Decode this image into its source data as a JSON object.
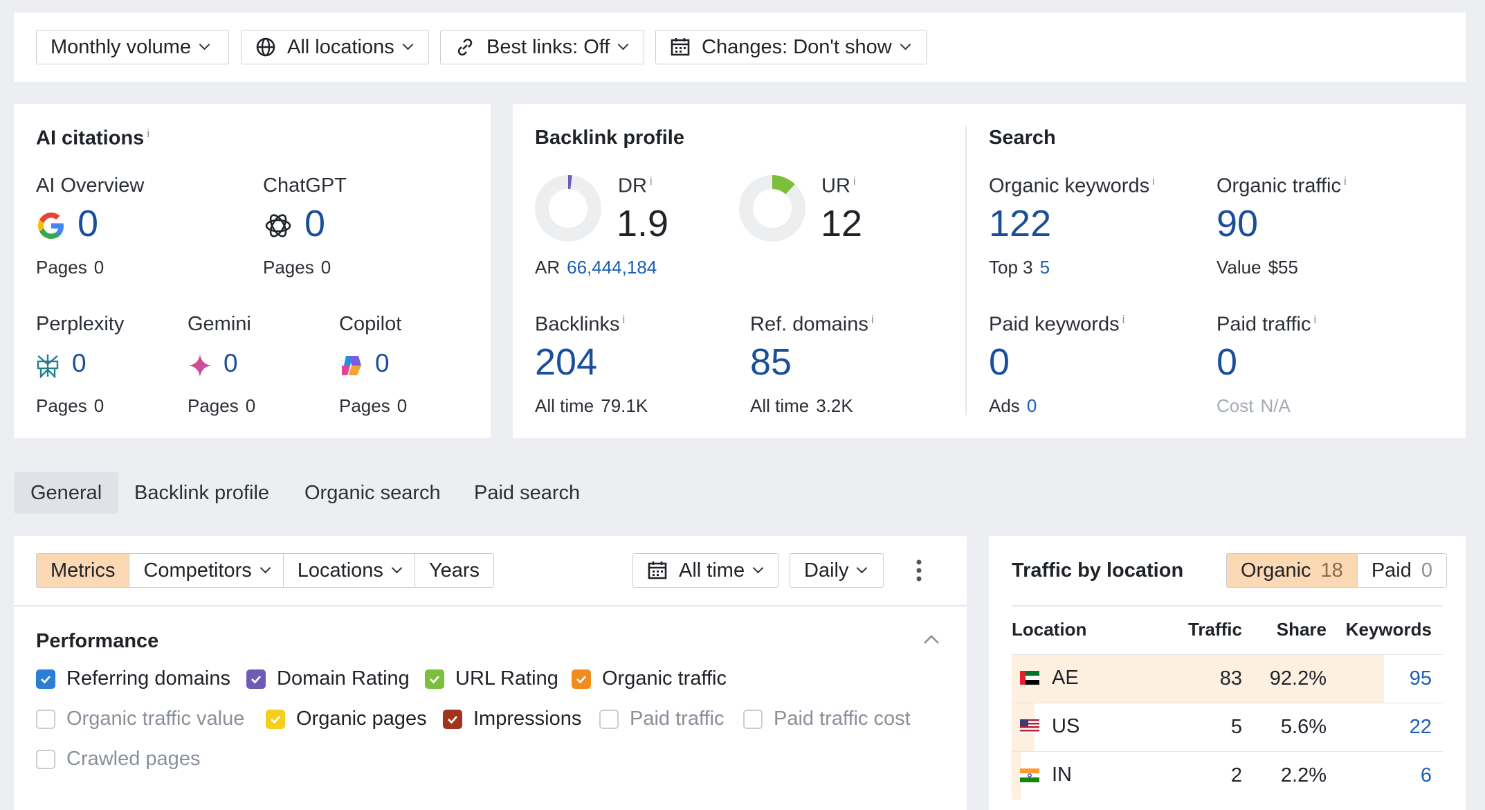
{
  "filters": {
    "volume": "Monthly volume",
    "locations": "All locations",
    "best_links": "Best links: Off",
    "changes": "Changes: Don't show"
  },
  "ai_citations": {
    "title": "AI citations",
    "info": "i",
    "overview": {
      "label": "AI Overview",
      "value": "0",
      "pages_label": "Pages",
      "pages": "0"
    },
    "chatgpt": {
      "label": "ChatGPT",
      "value": "0",
      "pages_label": "Pages",
      "pages": "0"
    },
    "perplexity": {
      "label": "Perplexity",
      "value": "0",
      "pages_label": "Pages",
      "pages": "0"
    },
    "gemini": {
      "label": "Gemini",
      "value": "0",
      "pages_label": "Pages",
      "pages": "0"
    },
    "copilot": {
      "label": "Copilot",
      "value": "0",
      "pages_label": "Pages",
      "pages": "0"
    }
  },
  "backlink_profile": {
    "title": "Backlink profile",
    "dr": {
      "label": "DR",
      "value": "1.9",
      "percent": 1.9
    },
    "ur": {
      "label": "UR",
      "value": "12",
      "percent": 12
    },
    "ar": {
      "label": "AR",
      "value": "66,444,184"
    },
    "backlinks": {
      "label": "Backlinks",
      "value": "204",
      "sub_label": "All time",
      "sub_value": "79.1K"
    },
    "ref_domains": {
      "label": "Ref. domains",
      "value": "85",
      "sub_label": "All time",
      "sub_value": "3.2K"
    }
  },
  "search": {
    "title": "Search",
    "organic_keywords": {
      "label": "Organic keywords",
      "value": "122",
      "sub_label": "Top 3",
      "sub_value": "5"
    },
    "organic_traffic": {
      "label": "Organic traffic",
      "value": "90",
      "sub_label": "Value",
      "sub_value": "$55"
    },
    "paid_keywords": {
      "label": "Paid keywords",
      "value": "0",
      "sub_label": "Ads",
      "sub_value": "0"
    },
    "paid_traffic": {
      "label": "Paid traffic",
      "value": "0",
      "sub_label": "Cost",
      "sub_value": "N/A"
    }
  },
  "tabs": [
    "General",
    "Backlink profile",
    "Organic search",
    "Paid search"
  ],
  "chart_toolbar": {
    "metrics": "Metrics",
    "competitors": "Competitors",
    "locations": "Locations",
    "years": "Years",
    "range": "All time",
    "interval": "Daily"
  },
  "performance": {
    "title": "Performance",
    "checkboxes": [
      {
        "label": "Referring domains",
        "checked": true,
        "color": "#2a7fd4"
      },
      {
        "label": "Domain Rating",
        "checked": true,
        "color": "#6e5bb8"
      },
      {
        "label": "URL Rating",
        "checked": true,
        "color": "#7cbf3c"
      },
      {
        "label": "Organic traffic",
        "checked": true,
        "color": "#f28b1e"
      },
      {
        "label": "Organic traffic value",
        "checked": false
      },
      {
        "label": "Organic pages",
        "checked": true,
        "color": "#f5cf1d"
      },
      {
        "label": "Impressions",
        "checked": true,
        "color": "#a2331f"
      },
      {
        "label": "Paid traffic",
        "checked": false
      },
      {
        "label": "Paid traffic cost",
        "checked": false
      },
      {
        "label": "Crawled pages",
        "checked": false
      }
    ]
  },
  "traffic_by_location": {
    "title": "Traffic by location",
    "organic_label": "Organic",
    "organic_count": "18",
    "paid_label": "Paid",
    "paid_count": "0",
    "columns": [
      "Location",
      "Traffic",
      "Share",
      "Keywords"
    ],
    "rows": [
      {
        "location": "AE",
        "traffic": "83",
        "share": "92.2%",
        "keywords": "95",
        "share_fraction": 0.922
      },
      {
        "location": "US",
        "traffic": "5",
        "share": "5.6%",
        "keywords": "22",
        "share_fraction": 0.056
      },
      {
        "location": "IN",
        "traffic": "2",
        "share": "2.2%",
        "keywords": "6",
        "share_fraction": 0.022
      }
    ]
  }
}
